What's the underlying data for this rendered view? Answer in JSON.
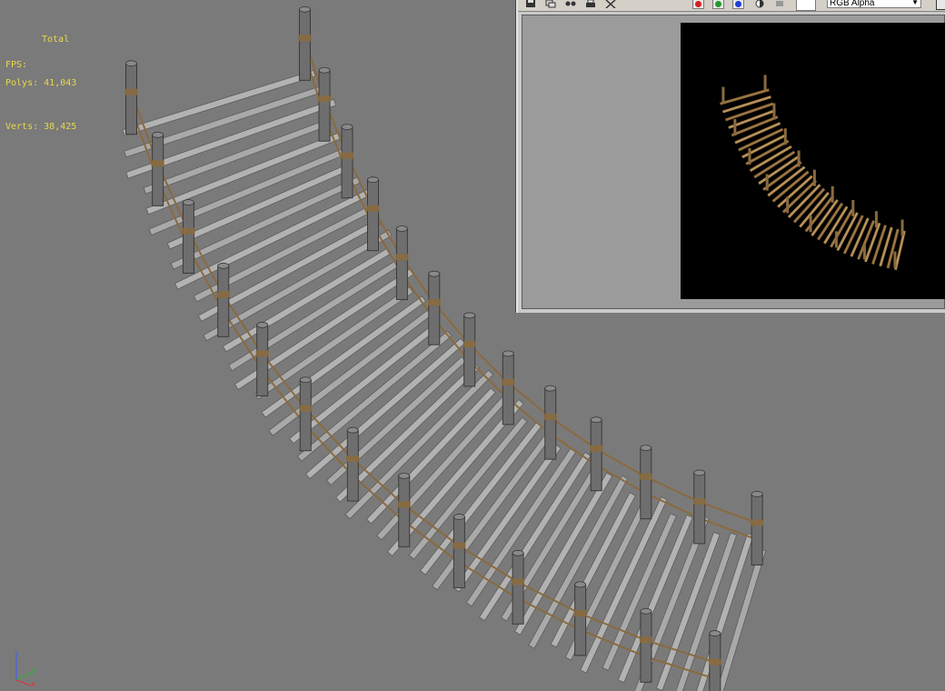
{
  "stats": {
    "header": "Total",
    "polys_label": "Polys:",
    "polys_value": "41,043",
    "verts_label": "Verts:",
    "verts_value": "38,425",
    "fps_label": "FPS:"
  },
  "render_window": {
    "channel_select": "RGB Alpha",
    "channel_buttons": [
      {
        "name": "red-channel",
        "color": "#d81e1e"
      },
      {
        "name": "green-channel",
        "color": "#1e9a2e"
      },
      {
        "name": "blue-channel",
        "color": "#1f3fd6"
      }
    ]
  },
  "axis_labels": {
    "z": "z",
    "y": "y",
    "x": "x"
  },
  "colors": {
    "viewport_bg": "#7a7a7a",
    "stats_text": "#e8d84a",
    "plank_fill": "#a9a9a9",
    "post_fill": "#6e6e6e",
    "rope": "#8a6a3e",
    "render_bg": "#000000",
    "render_wood": "#b8925a"
  }
}
